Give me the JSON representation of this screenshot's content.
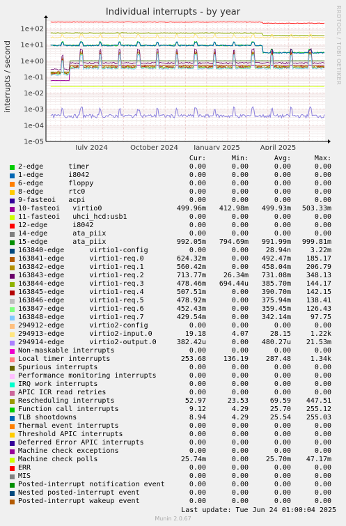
{
  "chart_data": {
    "type": "line",
    "title": "Individual interrupts - by year",
    "ylabel": "interrupts / second",
    "yscale": "log",
    "ylim": [
      1e-05,
      300
    ],
    "y_ticks": [
      "1e-05",
      "1e-04",
      "1e-03",
      "1e-02",
      "1e-01",
      "1e+00",
      "1e+01",
      "1e+02"
    ],
    "x_ticks": [
      "July 2024",
      "October 2024",
      "January 2025",
      "April 2025"
    ],
    "xlim": [
      "2024-05-10",
      "2025-06-24"
    ],
    "grid": true,
    "series": [
      {
        "name": "Local timer interrupts",
        "color": "#ff2828",
        "level": 253.68
      },
      {
        "name": "Rescheduling interrupts",
        "color": "#8fb300",
        "level": 52.97
      },
      {
        "name": "Machine check polls",
        "color": "#ccff00",
        "level": 0.02574
      },
      {
        "name": "Function call interrupts",
        "color": "#00cc00",
        "level": 9.12
      },
      {
        "name": "TLB shootdowns",
        "color": "#0066b3",
        "level": 8.94
      },
      {
        "name": "10-fasteoi virtio0",
        "color": "#990099",
        "level": 0.49996
      },
      {
        "name": "15-edge ata_piix",
        "color": "#336600",
        "level": 0.99205
      },
      {
        "name": "294914-edge virtio2-output.0",
        "color": "#8c81de",
        "level": 0.00038242
      }
    ]
  },
  "watermark": "RRDTOOL / TOBI OETIKER",
  "headers": {
    "cur": "Cur:",
    "min": "Min:",
    "avg": "Avg:",
    "max": "Max:"
  },
  "legend": [
    {
      "name": "2-edge      timer",
      "color": "#00cc00",
      "cur": "0.00",
      "min": "0.00",
      "avg": "0.00",
      "max": "0.00"
    },
    {
      "name": "1-edge      i8042",
      "color": "#0066b3",
      "cur": "0.00",
      "min": "0.00",
      "avg": "0.00",
      "max": "0.00"
    },
    {
      "name": "6-edge      floppy",
      "color": "#ff8000",
      "cur": "0.00",
      "min": "0.00",
      "avg": "0.00",
      "max": "0.00"
    },
    {
      "name": "8-edge      rtc0",
      "color": "#ffcc00",
      "cur": "0.00",
      "min": "0.00",
      "avg": "0.00",
      "max": "0.00"
    },
    {
      "name": "9-fasteoi   acpi",
      "color": "#330099",
      "cur": "0.00",
      "min": "0.00",
      "avg": "0.00",
      "max": "0.00"
    },
    {
      "name": "10-fasteoi   virtio0",
      "color": "#990099",
      "cur": "499.96m",
      "min": "412.98m",
      "avg": "499.93m",
      "max": "503.33m"
    },
    {
      "name": "11-fasteoi   uhci_hcd:usb1",
      "color": "#ccff00",
      "cur": "0.00",
      "min": "0.00",
      "avg": "0.00",
      "max": "0.00"
    },
    {
      "name": "12-edge      i8042",
      "color": "#ff0000",
      "cur": "0.00",
      "min": "0.00",
      "avg": "0.00",
      "max": "0.00"
    },
    {
      "name": "14-edge      ata_piix",
      "color": "#808080",
      "cur": "0.00",
      "min": "0.00",
      "avg": "0.00",
      "max": "0.00"
    },
    {
      "name": "15-edge      ata_piix",
      "color": "#008f00",
      "cur": "992.05m",
      "min": "794.69m",
      "avg": "991.99m",
      "max": "999.81m"
    },
    {
      "name": "163840-edge      virtio1-config",
      "color": "#00487d",
      "cur": "0.00",
      "min": "0.00",
      "avg": "28.94n",
      "max": "3.22m"
    },
    {
      "name": "163841-edge      virtio1-req.0",
      "color": "#b35a00",
      "cur": "624.32m",
      "min": "0.00",
      "avg": "492.47m",
      "max": "185.17"
    },
    {
      "name": "163842-edge      virtio1-req.1",
      "color": "#b38f00",
      "cur": "560.42m",
      "min": "0.00",
      "avg": "458.04m",
      "max": "206.79"
    },
    {
      "name": "163843-edge      virtio1-req.2",
      "color": "#6b006b",
      "cur": "713.77m",
      "min": "26.34m",
      "avg": "731.08m",
      "max": "348.13"
    },
    {
      "name": "163844-edge      virtio1-req.3",
      "color": "#8fb300",
      "cur": "478.46m",
      "min": "694.44u",
      "avg": "385.70m",
      "max": "144.17"
    },
    {
      "name": "163845-edge      virtio1-req.4",
      "color": "#b30000",
      "cur": "507.51m",
      "min": "0.00",
      "avg": "390.70m",
      "max": "142.15"
    },
    {
      "name": "163846-edge      virtio1-req.5",
      "color": "#bebebe",
      "cur": "478.92m",
      "min": "0.00",
      "avg": "375.94m",
      "max": "138.41"
    },
    {
      "name": "163847-edge      virtio1-req.6",
      "color": "#80ff80",
      "cur": "452.43m",
      "min": "0.00",
      "avg": "359.45m",
      "max": "126.43"
    },
    {
      "name": "163848-edge      virtio1-req.7",
      "color": "#80c9ff",
      "cur": "429.54m",
      "min": "0.00",
      "avg": "342.14m",
      "max": "97.75"
    },
    {
      "name": "294912-edge      virtio2-config",
      "color": "#ffc080",
      "cur": "0.00",
      "min": "0.00",
      "avg": "0.00",
      "max": "0.00"
    },
    {
      "name": "294913-edge      virtio2-input.0",
      "color": "#ffe680",
      "cur": "19.18",
      "min": "4.07",
      "avg": "28.15",
      "max": "1.22k"
    },
    {
      "name": "294914-edge      virtio2-output.0",
      "color": "#aa80ff",
      "cur": "382.42u",
      "min": "0.00",
      "avg": "480.27u",
      "max": "21.53m"
    },
    {
      "name": "Non-maskable interrupts",
      "color": "#ee00cc",
      "cur": "0.00",
      "min": "0.00",
      "avg": "0.00",
      "max": "0.00"
    },
    {
      "name": "Local timer interrupts",
      "color": "#ff8080",
      "cur": "253.68",
      "min": "136.19",
      "avg": "287.48",
      "max": "1.34k"
    },
    {
      "name": "Spurious interrupts",
      "color": "#666600",
      "cur": "0.00",
      "min": "0.00",
      "avg": "0.00",
      "max": "0.00"
    },
    {
      "name": "Performance monitoring interrupts",
      "color": "#ffbfff",
      "cur": "0.00",
      "min": "0.00",
      "avg": "0.00",
      "max": "0.00"
    },
    {
      "name": "IRQ work interrupts",
      "color": "#00ffcc",
      "cur": "0.00",
      "min": "0.00",
      "avg": "0.00",
      "max": "0.00"
    },
    {
      "name": "APIC ICR read retries",
      "color": "#cc6699",
      "cur": "0.00",
      "min": "0.00",
      "avg": "0.00",
      "max": "0.00"
    },
    {
      "name": "Rescheduling interrupts",
      "color": "#999900",
      "cur": "52.97",
      "min": "23.53",
      "avg": "69.59",
      "max": "447.51"
    },
    {
      "name": "Function call interrupts",
      "color": "#00cc00",
      "cur": "9.12",
      "min": "4.29",
      "avg": "25.70",
      "max": "255.12"
    },
    {
      "name": "TLB shootdowns",
      "color": "#0066b3",
      "cur": "8.94",
      "min": "4.29",
      "avg": "25.54",
      "max": "255.03"
    },
    {
      "name": "Thermal event interrupts",
      "color": "#ff8000",
      "cur": "0.00",
      "min": "0.00",
      "avg": "0.00",
      "max": "0.00"
    },
    {
      "name": "Threshold APIC interrupts",
      "color": "#ffcc00",
      "cur": "0.00",
      "min": "0.00",
      "avg": "0.00",
      "max": "0.00"
    },
    {
      "name": "Deferred Error APIC interrupts",
      "color": "#330099",
      "cur": "0.00",
      "min": "0.00",
      "avg": "0.00",
      "max": "0.00"
    },
    {
      "name": "Machine check exceptions",
      "color": "#990099",
      "cur": "0.00",
      "min": "0.00",
      "avg": "0.00",
      "max": "0.00"
    },
    {
      "name": "Machine check polls",
      "color": "#ccff00",
      "cur": "25.74m",
      "min": "0.00",
      "avg": "25.70m",
      "max": "47.17m"
    },
    {
      "name": "ERR",
      "color": "#ff0000",
      "cur": "0.00",
      "min": "0.00",
      "avg": "0.00",
      "max": "0.00"
    },
    {
      "name": "MIS",
      "color": "#808080",
      "cur": "0.00",
      "min": "0.00",
      "avg": "0.00",
      "max": "0.00"
    },
    {
      "name": "Posted-interrupt notification event",
      "color": "#008f00",
      "cur": "0.00",
      "min": "0.00",
      "avg": "0.00",
      "max": "0.00"
    },
    {
      "name": "Nested posted-interrupt event",
      "color": "#00487d",
      "cur": "0.00",
      "min": "0.00",
      "avg": "0.00",
      "max": "0.00"
    },
    {
      "name": "Posted-interrupt wakeup event",
      "color": "#b35a00",
      "cur": "0.00",
      "min": "0.00",
      "avg": "0.00",
      "max": "0.00"
    }
  ],
  "last_update": "Last update: Tue Jun 24 01:00:04 2025",
  "footer": "Munin 2.0.67"
}
